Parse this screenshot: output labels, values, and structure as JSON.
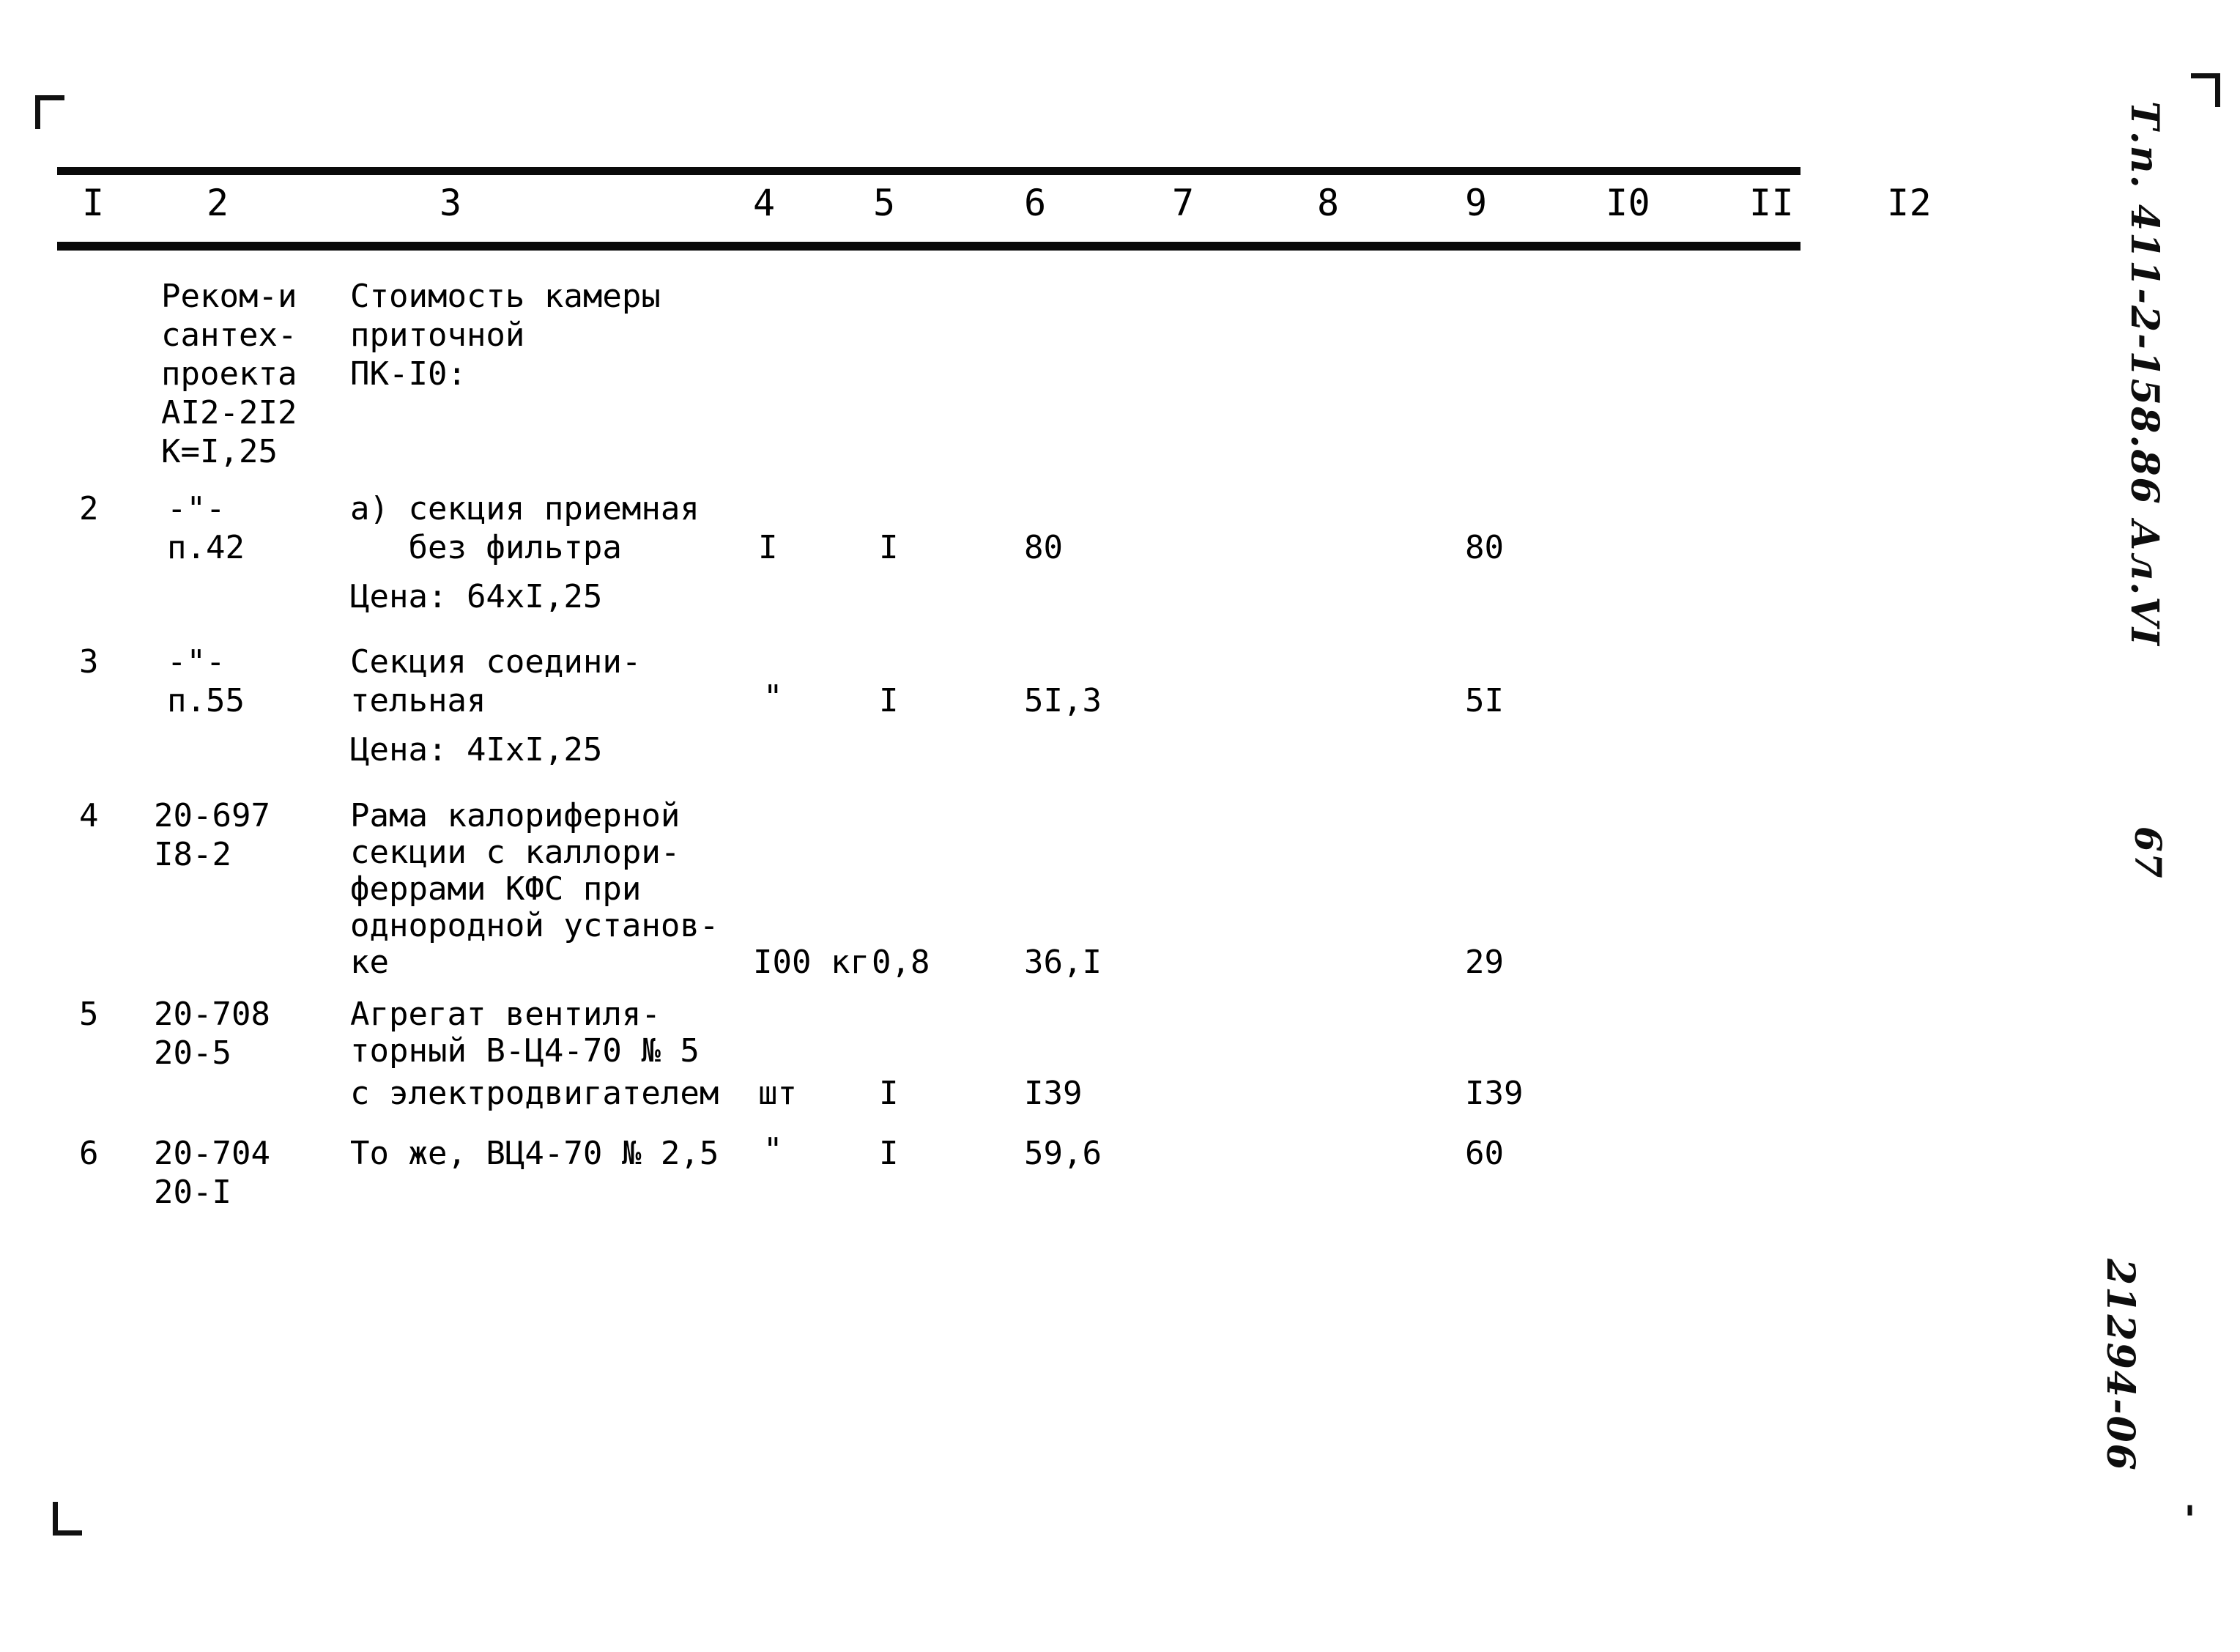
{
  "document": {
    "type": "typewritten-estimate-table",
    "margin_notes": {
      "spec_title": "Т.п. 411-2-158.86  Ал.VI",
      "page_number": "67",
      "archive_code": "21294-06",
      "bottom_dash": "-"
    }
  },
  "table": {
    "column_headers": [
      "I",
      "2",
      "3",
      "4",
      "5",
      "6",
      "7",
      "8",
      "9",
      "I0",
      "II",
      "I2"
    ],
    "rows": [
      {
        "num": "",
        "col2": "Реком-и\nсантех-\nпроекта\nАI2-2I2\nК=I,25",
        "col3": "Стоимость камеры\nприточной\nПК-I0:",
        "col4": "",
        "col5": "",
        "col6": "",
        "col9": ""
      },
      {
        "num": "2",
        "col2": "-\"-\nп.42",
        "col3_line1": "а) секция приемная",
        "col3_line2": "   без фильтра",
        "col3_line3": "Цена: 64хI,25",
        "col4": "I",
        "col5": "I",
        "col6": "80",
        "col9": "80"
      },
      {
        "num": "3",
        "col2": "-\"-\nп.55",
        "col3_line1": "Секция соедини-",
        "col3_line2": "тельная",
        "col3_line3": "Цена: 4IхI,25",
        "col4": "\"",
        "col5": "I",
        "col6": "5I,3",
        "col9": "5I"
      },
      {
        "num": "4",
        "col2": "20-697\nI8-2",
        "col3_line1": "Рама калориферной",
        "col3_line2": "секции с каллори-",
        "col3_line3": "феррами КФС при",
        "col3_line4": "однородной установ-",
        "col3_line5": "ке",
        "col4": "I00 кг",
        "col5": "0,8",
        "col6": "36,I",
        "col9": "29"
      },
      {
        "num": "5",
        "col2": "20-708\n20-5",
        "col3_line1": "Агрегат вентиля-",
        "col3_line2": "торный В-Ц4-70 № 5",
        "col3_line3": "с электродвигателем",
        "col4": "шт",
        "col5": "I",
        "col6": "I39",
        "col9": "I39"
      },
      {
        "num": "6",
        "col2": "20-704\n20-I",
        "col3_line1": "То же, ВЦ4-70 № 2,5",
        "col4": "\"",
        "col5": "I",
        "col6": "59,6",
        "col9": "60"
      }
    ]
  }
}
